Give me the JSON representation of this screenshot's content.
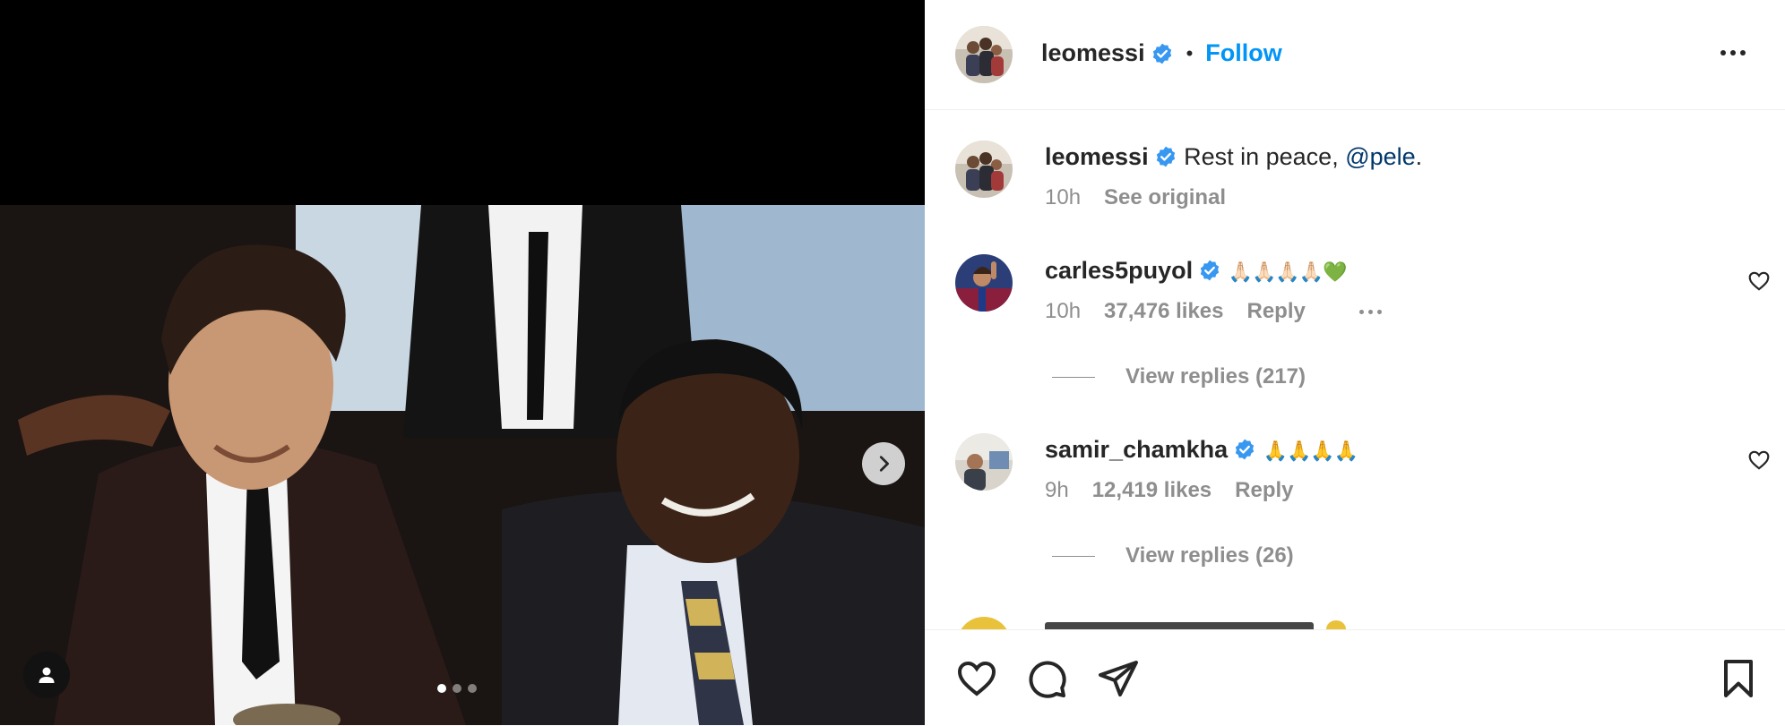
{
  "post": {
    "author": "leomessi",
    "follow_label": "Follow",
    "separator": "•",
    "carousel": {
      "slide_count": 3,
      "active_index": 0
    }
  },
  "caption": {
    "username": "leomessi",
    "text": "Rest in peace, ",
    "mention": "@pele",
    "text_end": ".",
    "time": "10h",
    "see_original": "See original"
  },
  "comments": [
    {
      "username": "carles5puyol",
      "text": "🙏🏻🙏🏻🙏🏻🙏🏻💚",
      "time": "10h",
      "likes": "37,476 likes",
      "reply": "Reply",
      "view_replies": "View replies (217)"
    },
    {
      "username": "samir_chamkha",
      "text": "🙏🙏🙏🙏",
      "time": "9h",
      "likes": "12,419 likes",
      "reply": "Reply",
      "view_replies": "View replies (26)"
    }
  ],
  "colors": {
    "link": "#0095f6",
    "mention": "#00376b",
    "muted": "#8e8e8e",
    "verified": "#3897f0"
  },
  "icons": [
    "verified-badge-icon",
    "more-options-icon",
    "heart-icon",
    "comment-icon",
    "share-icon",
    "bookmark-icon",
    "chevron-right-icon",
    "user-tag-icon"
  ]
}
